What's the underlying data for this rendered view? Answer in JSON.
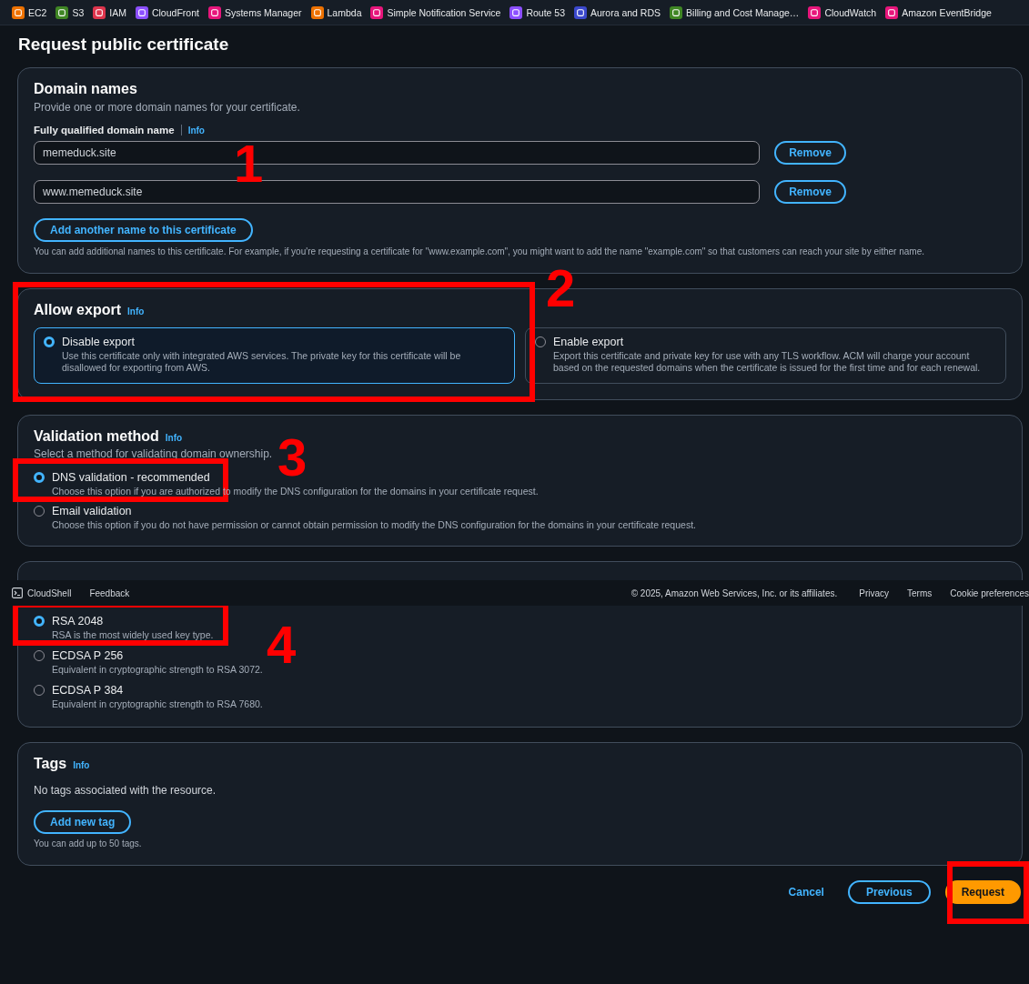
{
  "service_bar": [
    {
      "label": "EC2",
      "color": "#ed7100"
    },
    {
      "label": "S3",
      "color": "#3f8624"
    },
    {
      "label": "IAM",
      "color": "#dd344c"
    },
    {
      "label": "CloudFront",
      "color": "#8c4fff"
    },
    {
      "label": "Systems Manager",
      "color": "#e7157b"
    },
    {
      "label": "Lambda",
      "color": "#ed7100"
    },
    {
      "label": "Simple Notification Service",
      "color": "#e7157b"
    },
    {
      "label": "Route 53",
      "color": "#8c4fff"
    },
    {
      "label": "Aurora and RDS",
      "color": "#3b48cc"
    },
    {
      "label": "Billing and Cost Manage…",
      "color": "#3f8624"
    },
    {
      "label": "CloudWatch",
      "color": "#e7157b"
    },
    {
      "label": "Amazon EventBridge",
      "color": "#e7157b"
    }
  ],
  "page_title": "Request public certificate",
  "domain_names": {
    "title": "Domain names",
    "description": "Provide one or more domain names for your certificate.",
    "field_label": "Fully qualified domain name",
    "info": "Info",
    "fields": [
      {
        "value": "memeduck.site",
        "button": "Remove"
      },
      {
        "value": "www.memeduck.site",
        "button": "Remove"
      }
    ],
    "add_button": "Add another name to this certificate",
    "hint": "You can add additional names to this certificate. For example, if you're requesting a certificate for \"www.example.com\", you might want to add the name \"example.com\" so that customers can reach your site by either name."
  },
  "allow_export": {
    "title": "Allow export",
    "info": "Info",
    "options": [
      {
        "label": "Disable export",
        "description": "Use this certificate only with integrated AWS services. The private key for this certificate will be disallowed for exporting from AWS.",
        "selected": true
      },
      {
        "label": "Enable export",
        "description": "Export this certificate and private key for use with any TLS workflow. ACM will charge your account based on the requested domains when the certificate is issued for the first time and for each renewal.",
        "selected": false
      }
    ]
  },
  "validation_method": {
    "title": "Validation method",
    "info": "Info",
    "description": "Select a method for validating domain ownership.",
    "options": [
      {
        "label": "DNS validation - recommended",
        "description": "Choose this option if you are authorized to modify the DNS configuration for the domains in your certificate request.",
        "selected": true
      },
      {
        "label": "Email validation",
        "description": "Choose this option if you do not have permission or cannot obtain permission to modify the DNS configuration for the domains in your certificate request.",
        "selected": false
      }
    ]
  },
  "key_algorithm": {
    "options": [
      {
        "label": "RSA 2048",
        "description": "RSA is the most widely used key type.",
        "selected": true
      },
      {
        "label": "ECDSA P 256",
        "description": "Equivalent in cryptographic strength to RSA 3072.",
        "selected": false
      },
      {
        "label": "ECDSA P 384",
        "description": "Equivalent in cryptographic strength to RSA 7680.",
        "selected": false
      }
    ]
  },
  "tags": {
    "title": "Tags",
    "info": "Info",
    "empty_text": "No tags associated with the resource.",
    "add_button": "Add new tag",
    "hint": "You can add up to 50 tags."
  },
  "actions": [
    {
      "label": "Cancel",
      "kind": "link"
    },
    {
      "label": "Previous",
      "kind": "secondary"
    },
    {
      "label": "Request",
      "kind": "primary"
    }
  ],
  "footer": {
    "cloudshell": "CloudShell",
    "feedback": "Feedback",
    "copyright": "© 2025, Amazon Web Services, Inc. or its affiliates.",
    "links": [
      "Privacy",
      "Terms",
      "Cookie preferences"
    ]
  },
  "annotations": [
    {
      "number": "1",
      "boxed": false
    },
    {
      "number": "2",
      "boxed": true
    },
    {
      "number": "3",
      "boxed": true
    },
    {
      "number": "4",
      "boxed": true
    },
    {
      "boxed": true
    }
  ]
}
